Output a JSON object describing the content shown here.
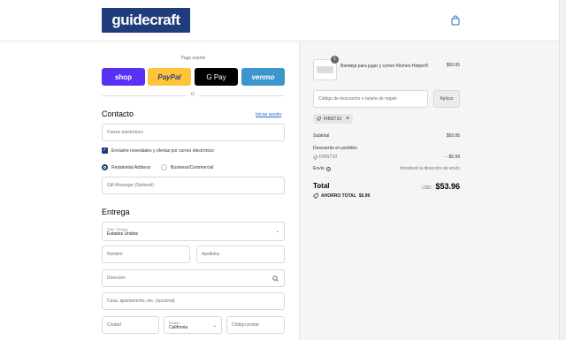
{
  "header": {
    "logo_text": "guidecraft",
    "cart_icon": "shopping-bag-icon"
  },
  "express": {
    "label": "Pago exprés",
    "buttons": [
      "shop",
      "PayPal",
      "G Pay",
      "venmo"
    ],
    "or_text": "O"
  },
  "contact": {
    "title": "Contacto",
    "login_link": "Iniciar sesión",
    "email_placeholder": "Correo electrónico",
    "newsletter_label": "Envíame novedades y ofertas por correo electrónico",
    "newsletter_checked": true,
    "address_types": [
      "Residential Address",
      "Business/Commercial"
    ],
    "address_type_selected": "Residential Address",
    "gift_message_placeholder": "Gift Message (Optional)"
  },
  "delivery": {
    "title": "Entrega",
    "country_label": "País / Región",
    "country_value": "Estados Unidos",
    "first_name_placeholder": "Nombre",
    "last_name_placeholder": "Apellidos",
    "address_placeholder": "Dirección",
    "apartment_placeholder": "Casa, apartamento, etc. (opcional)",
    "city_placeholder": "Ciudad",
    "state_label": "Estado",
    "state_value": "California",
    "zip_placeholder": "Código postal"
  },
  "order": {
    "item": {
      "quantity": "1",
      "name": "Bandeja para jugar y comer Kitchen Helper®",
      "price": "$59.95"
    },
    "discount_placeholder": "Código de descuento o tarjeta de regalo",
    "apply_label": "Aplicar",
    "applied_code": "FIRST10",
    "subtotal_label": "Subtotal",
    "subtotal_value": "$59.95",
    "order_discount_label": "Descuento en pedidos",
    "discount_code": "FIRST10",
    "discount_value": "− $5.99",
    "shipping_label": "Envío",
    "shipping_value": "Introducir la dirección de envío",
    "total_label": "Total",
    "currency": "USD",
    "total_value": "$53.96",
    "savings_label": "AHORRO TOTAL",
    "savings_value": "$5.99"
  },
  "colors": {
    "brand": "#1f3d7a",
    "shop_pay": "#5a31f4",
    "paypal": "#ffc439",
    "venmo": "#3d95ce",
    "link": "#1f6fbf"
  }
}
